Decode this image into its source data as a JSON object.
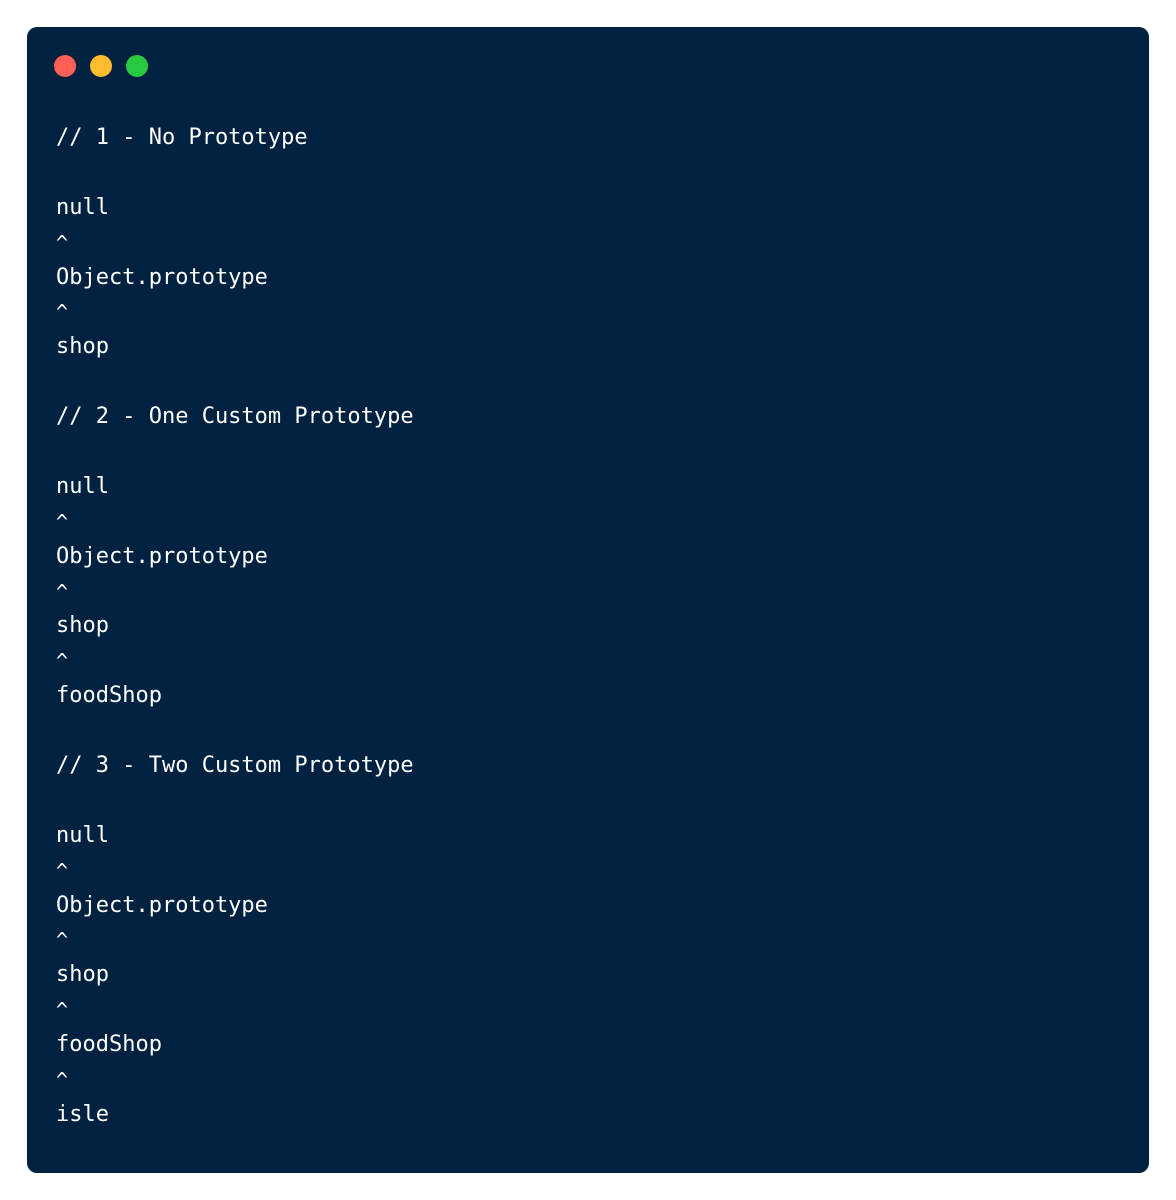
{
  "window": {
    "controls": [
      {
        "name": "close-button",
        "icon": "red-circle-icon",
        "color": "#ff5f57"
      },
      {
        "name": "minimize-button",
        "icon": "yellow-circle-icon",
        "color": "#febc2e"
      },
      {
        "name": "maximize-button",
        "icon": "green-circle-icon",
        "color": "#28c840"
      }
    ],
    "background": "#002240"
  },
  "code": {
    "lines": [
      "// 1 - No Prototype",
      "",
      "null",
      "^",
      "Object.prototype",
      "^",
      "shop",
      "",
      "// 2 - One Custom Prototype",
      "",
      "null",
      "^",
      "Object.prototype",
      "^",
      "shop",
      "^",
      "foodShop",
      "",
      "// 3 - Two Custom Prototype",
      "",
      "null",
      "^",
      "Object.prototype",
      "^",
      "shop",
      "^",
      "foodShop",
      "^",
      "isle"
    ]
  }
}
